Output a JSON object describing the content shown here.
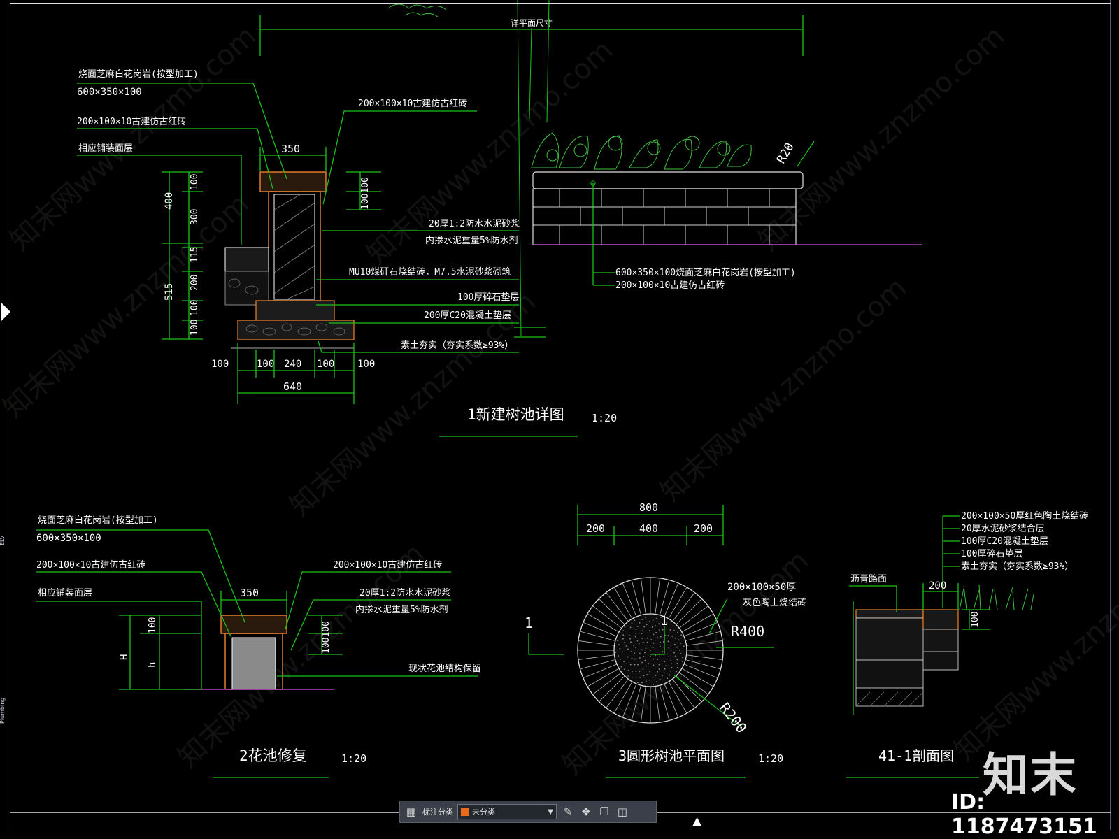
{
  "sidebar": {
    "labels": [
      "ELV",
      "Plumbing"
    ]
  },
  "detail1": {
    "top_dim": "详平面尺寸",
    "cap_label": "烧面芝麻白花岗岩(按型加工)",
    "cap_size": "600×350×100",
    "brick_left": "200×100×10古建仿古红砖",
    "paving": "相应铺装面层",
    "brick_right": "200×100×10古建仿古红砖",
    "mortar1": "20厚1:2防水水泥砂浆",
    "mortar2": "内掺水泥重量5%防水剂",
    "masonry": "MU10煤矸石烧结砖，M7.5水泥砂浆砌筑",
    "gravel": "100厚碎石垫层",
    "concrete": "200厚C20混凝土垫层",
    "soil": "素土夯实（夯实系数≥93%）",
    "dim_350": "350",
    "dims_left_outer": [
      "400",
      "515"
    ],
    "dims_left_inner": [
      "100",
      "300",
      "115",
      "200",
      "100",
      "100"
    ],
    "dim_right_stack": "100100",
    "dims_bottom": [
      "100",
      "100",
      "240",
      "100",
      "100"
    ],
    "dim_640": "640",
    "title": "1新建树池详图",
    "scale": "1:20",
    "elev_r20": "R20",
    "elev_label1": "600×350×100烧面芝麻白花岗岩(按型加工)",
    "elev_label2": "200×100×10古建仿古红砖"
  },
  "detail2": {
    "cap_label": "烧面芝麻白花岗岩(按型加工)",
    "cap_size": "600×350×100",
    "brick_left": "200×100×10古建仿古红砖",
    "paving": "相应铺装面层",
    "brick_right": "200×100×10古建仿古红砖",
    "mortar1": "20厚1:2防水水泥砂浆",
    "mortar2": "内掺水泥重量5%防水剂",
    "existing": "现状花池结构保留",
    "dim_350": "350",
    "dim_H": "H",
    "dim_h": "h",
    "dim_100a": "100",
    "dim_100b": "100100",
    "title": "2花池修复",
    "scale": "1:20"
  },
  "detail3": {
    "dim_800": "800",
    "dims_sub": [
      "200",
      "400",
      "200"
    ],
    "paver": "200×100×50厚",
    "paver2": "灰色陶土烧结砖",
    "r400": "R400",
    "r200": "R200",
    "mark_1a": "1",
    "mark_1b": "1",
    "title": "3圆形树池平面图",
    "scale": "1:20"
  },
  "detail4": {
    "layers": [
      "200×100×50厚红色陶土烧结砖",
      "20厚水泥砂浆结合层",
      "100厚C20混凝土垫层",
      "100厚碎石垫层",
      "素土夯实（夯实系数≥93%）"
    ],
    "asphalt": "沥青路面",
    "dim_200": "200",
    "dim_100": "100",
    "title": "41-1剖面图"
  },
  "toolbar": {
    "annotate_label": "标注分类",
    "category_value": "未分类",
    "category_color": "#e86a1a",
    "icons": [
      "grid-icon",
      "edit-icon",
      "move-icon",
      "copy-icon",
      "paste-icon"
    ]
  },
  "watermark": {
    "text": "知末网www.znzmo.com"
  },
  "brand": {
    "logo": "知末",
    "id": "ID: 1187473151"
  }
}
